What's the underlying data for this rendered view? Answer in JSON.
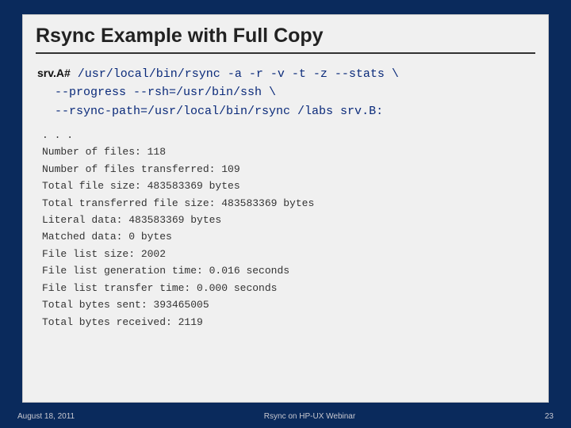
{
  "title": "Rsync Example with Full Copy",
  "command": {
    "prompt": "srv.A#",
    "line1_rest": " /usr/local/bin/rsync -a -r -v -t -z --stats \\",
    "line2": "--progress --rsh=/usr/bin/ssh \\",
    "line3": "--rsync-path=/usr/local/bin/rsync /labs srv.B:"
  },
  "output": {
    "ellipsis": ". . .",
    "lines": [
      "Number of files: 118",
      "Number of files transferred: 109",
      "Total file size: 483583369 bytes",
      "Total transferred file size: 483583369 bytes",
      "Literal data: 483583369 bytes",
      "Matched data: 0 bytes",
      "File list size: 2002",
      "File list generation time: 0.016 seconds",
      "File list transfer time: 0.000 seconds",
      "Total bytes sent: 393465005",
      "Total bytes received: 2119"
    ]
  },
  "footer": {
    "date": "August 18, 2011",
    "center": "Rsync on HP-UX Webinar",
    "page": "23"
  }
}
